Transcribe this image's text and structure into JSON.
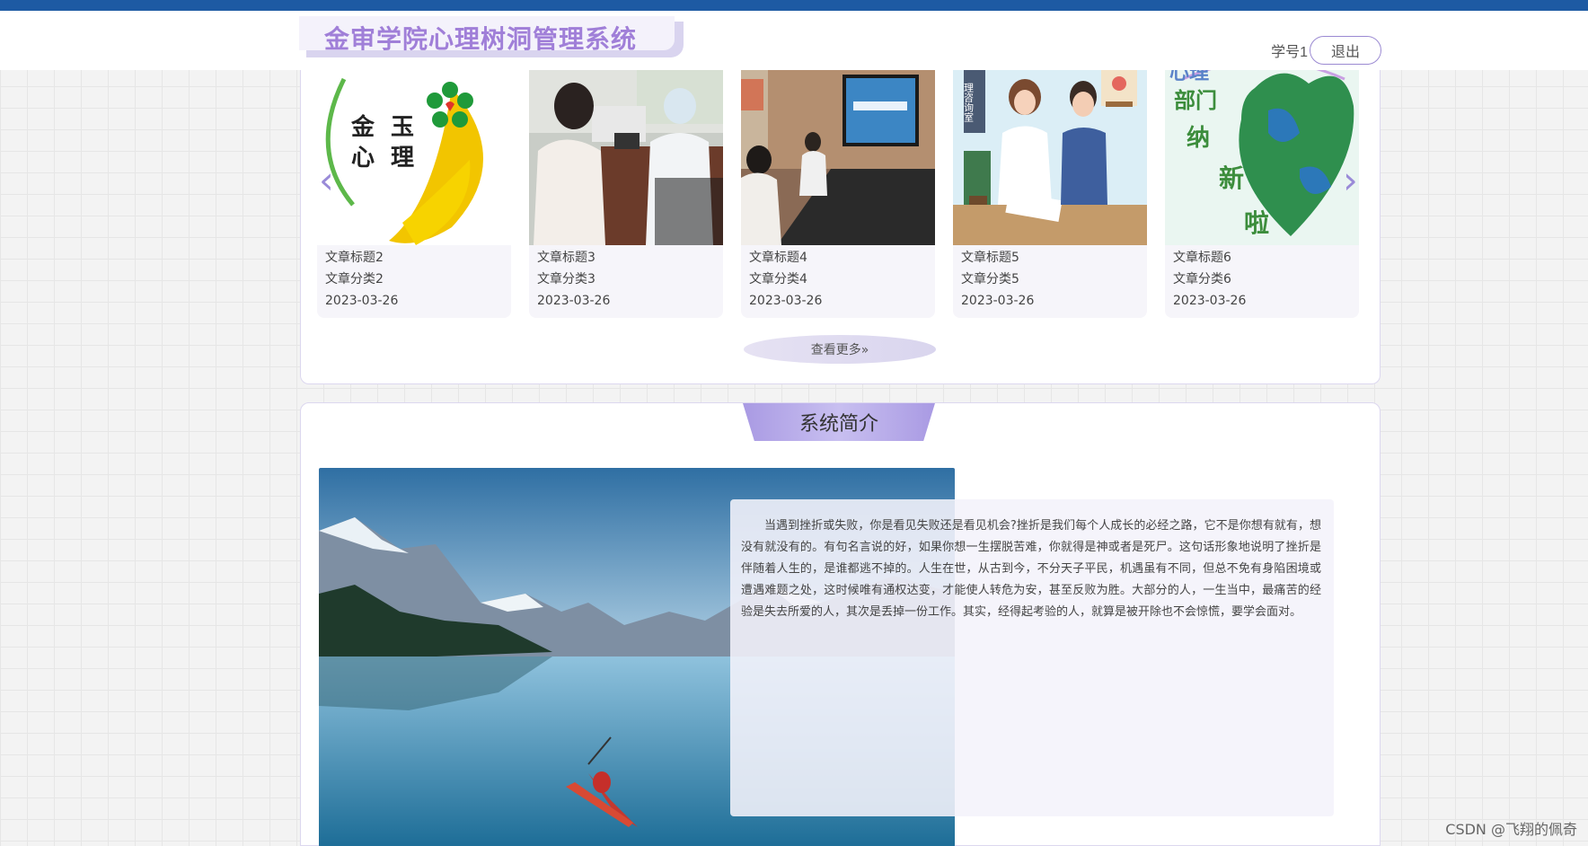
{
  "header": {
    "title": "金审学院心理树洞管理系统",
    "username": "学号1",
    "logout_label": "退出"
  },
  "articles": [
    {
      "title": "文章标题2",
      "category": "文章分类2",
      "date": "2023-03-26"
    },
    {
      "title": "文章标题3",
      "category": "文章分类3",
      "date": "2023-03-26"
    },
    {
      "title": "文章标题4",
      "category": "文章分类4",
      "date": "2023-03-26"
    },
    {
      "title": "文章标题5",
      "category": "文章分类5",
      "date": "2023-03-26"
    },
    {
      "title": "文章标题6",
      "category": "文章分类6",
      "date": "2023-03-26"
    }
  ],
  "card1_logo": {
    "line1a": "金",
    "line1b": "玉",
    "line2a": "心",
    "line2b": "理"
  },
  "card5_poster": {
    "text_top": "心理",
    "text_left": "部门",
    "text_mid": "纳",
    "text_bottom": "新",
    "text_last": "啦"
  },
  "card4_sign": "理咨询室",
  "carousel": {
    "prev_icon": "‹",
    "next_icon": "›"
  },
  "more_label": "查看更多»",
  "intro": {
    "heading": "系统简介",
    "text": "当遇到挫折或失败，你是看见失败还是看见机会?挫折是我们每个人成长的必经之路，它不是你想有就有，想没有就没有的。有句名言说的好，如果你想一生摆脱苦难，你就得是神或者是死尸。这句话形象地说明了挫折是伴随着人生的，是谁都逃不掉的。人生在世，从古到今，不分天子平民，机遇虽有不同，但总不免有身陷困境或遭遇难题之处，这时候唯有通权达变，才能使人转危为安，甚至反败为胜。大部分的人，一生当中，最痛苦的经验是失去所爱的人，其次是丢掉一份工作。其实，经得起考验的人，就算是被开除也不会惊慌，要学会面对。"
  },
  "watermark": "CSDN @飞翔的佩奇",
  "colors": {
    "accent": "#a07fd8",
    "topbar": "#1d5aa3",
    "tab": "#a99ae3"
  }
}
